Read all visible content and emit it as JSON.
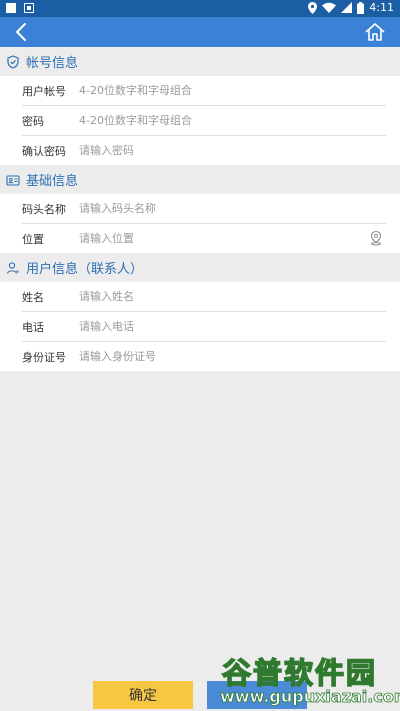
{
  "statusbar": {
    "time": "4:11",
    "icons": [
      "notification-square-icon",
      "notification-image-icon",
      "location-icon",
      "wifi-icon",
      "signal-icon",
      "battery-icon"
    ]
  },
  "appbar": {
    "back_icon": "chevron-left-icon",
    "home_icon": "home-icon"
  },
  "sections": {
    "account": {
      "title": "帐号信息",
      "icon": "shield-icon",
      "fields": {
        "username": {
          "label": "用户帐号",
          "placeholder": "4-20位数字和字母组合",
          "value": ""
        },
        "password": {
          "label": "密码",
          "placeholder": "4-20位数字和字母组合",
          "value": ""
        },
        "confirm": {
          "label": "确认密码",
          "placeholder": "请输入密码",
          "value": ""
        }
      }
    },
    "basic": {
      "title": "基础信息",
      "icon": "id-card-icon",
      "fields": {
        "dock_name": {
          "label": "码头名称",
          "placeholder": "请输入码头名称",
          "value": ""
        },
        "location": {
          "label": "位置",
          "placeholder": "请输入位置",
          "value": "",
          "icon": "map-pin-icon"
        }
      }
    },
    "user": {
      "title": "用户信息（联系人）",
      "icon": "user-icon",
      "fields": {
        "name": {
          "label": "姓名",
          "placeholder": "请输入姓名",
          "value": ""
        },
        "phone": {
          "label": "电话",
          "placeholder": "请输入电话",
          "value": ""
        },
        "id_number": {
          "label": "身份证号",
          "placeholder": "请输入身份证号",
          "value": ""
        }
      }
    }
  },
  "buttons": {
    "confirm_label": "确定"
  },
  "watermark": {
    "title": "谷普软件园",
    "url": "www.gupuxiazai.com"
  },
  "colors": {
    "statusbar": "#1b5ea3",
    "appbar": "#3b82d6",
    "section_title": "#2d6fb5",
    "confirm_button": "#f7c744",
    "secondary_button": "#4a8ad6"
  }
}
